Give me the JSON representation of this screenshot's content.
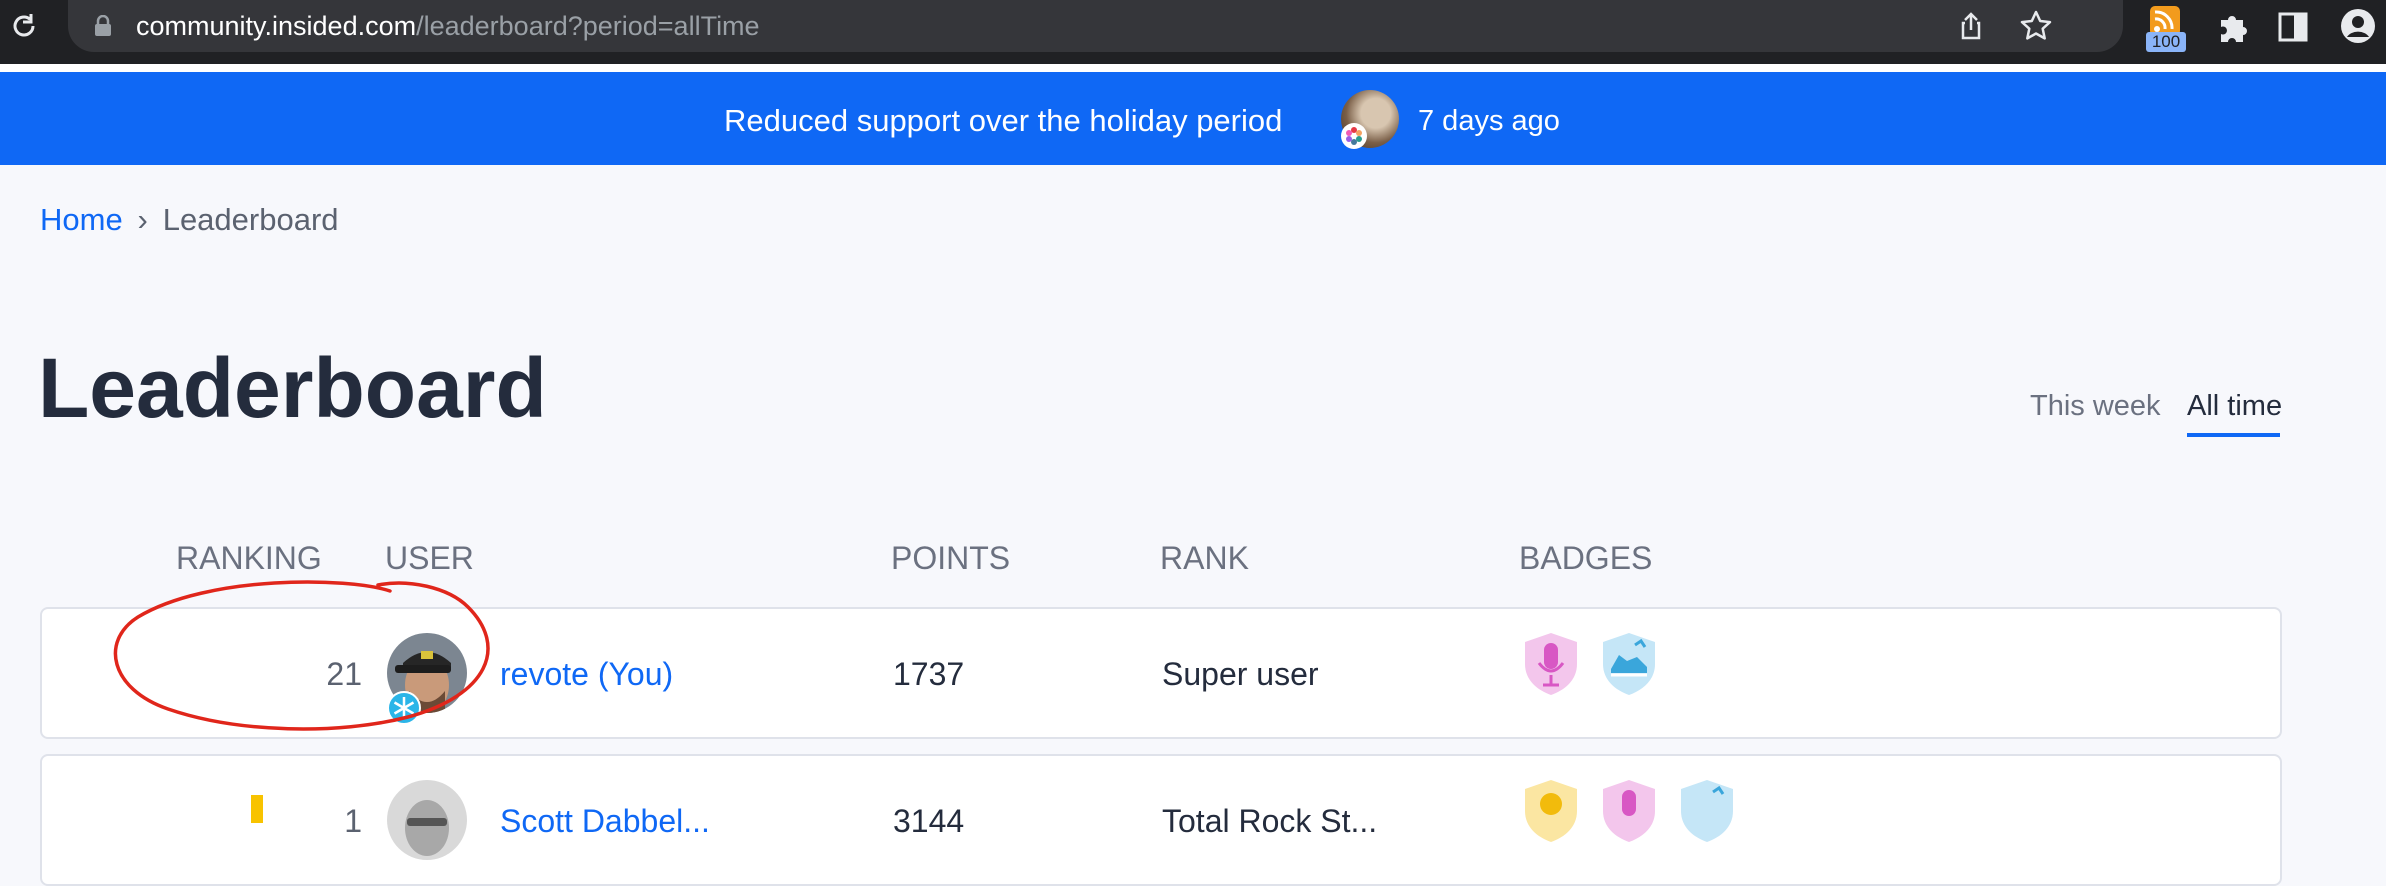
{
  "browser": {
    "url_host": "community.insided.com",
    "url_path": "/leaderboard?period=allTime",
    "extension_badge": "100",
    "icons": [
      "reload-icon",
      "lock-icon",
      "share-icon",
      "star-icon",
      "rss-icon",
      "puzzle-icon",
      "sidepanel-icon",
      "profile-icon"
    ]
  },
  "banner": {
    "text": "Reduced support over the holiday period",
    "time": "7 days ago"
  },
  "breadcrumb": {
    "home": "Home",
    "separator": "›",
    "current": "Leaderboard"
  },
  "page": {
    "title": "Leaderboard"
  },
  "tabs": [
    {
      "label": "This week",
      "active": false
    },
    {
      "label": "All time",
      "active": true
    }
  ],
  "table": {
    "headers": {
      "ranking": "RANKING",
      "user": "USER",
      "points": "POINTS",
      "rank": "RANK",
      "badges": "BADGES"
    },
    "rows": [
      {
        "ranking": "21",
        "user": "revote (You)",
        "points": "1737",
        "rank": "Super user",
        "badges": [
          "microphone-badge",
          "sneaker-badge"
        ]
      },
      {
        "ranking": "1",
        "user": "Scott Dabbel...",
        "points": "3144",
        "rank": "Total Rock St...",
        "badges": [
          "lightbulb-badge",
          "microphone-badge",
          "sneaker-badge"
        ]
      }
    ]
  },
  "colors": {
    "accent": "#0f68f5",
    "banner": "#0f68f5",
    "annotation": "#e0261b",
    "gold": "#f8c300"
  }
}
